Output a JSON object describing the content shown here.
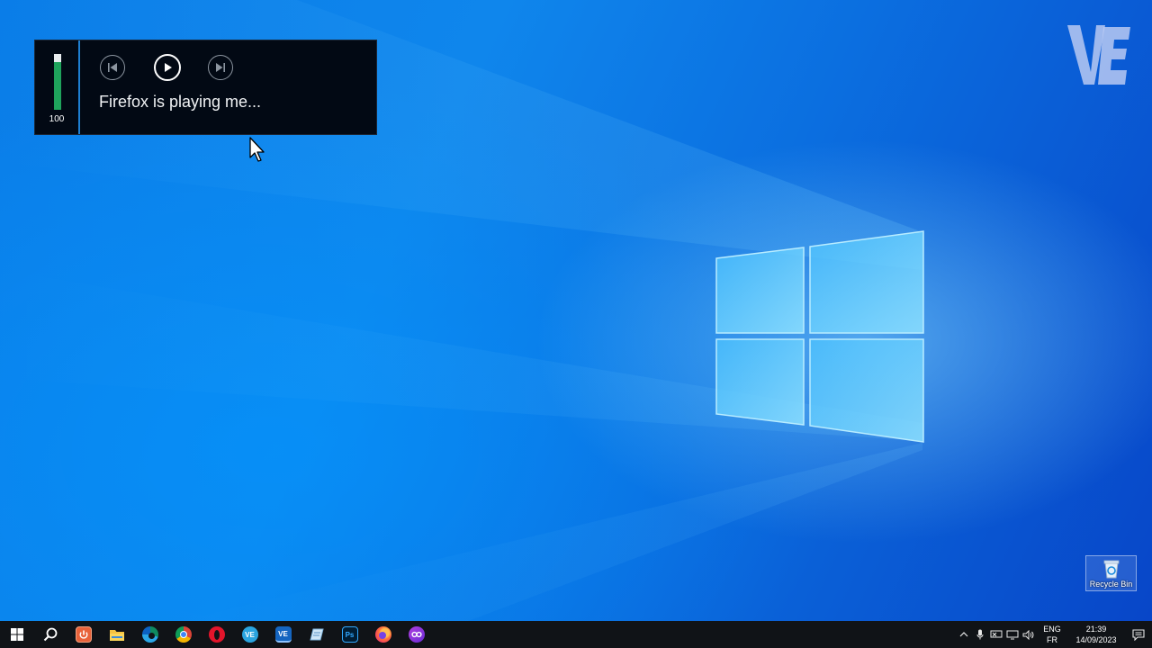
{
  "media": {
    "volume_level": 100,
    "volume_label": "100",
    "title": "Firefox is playing me...",
    "controls": {
      "previous": "previous-track",
      "play": "play",
      "next": "next-track"
    },
    "accent_color": "#1e7fd1",
    "volume_color": "#1fa35c"
  },
  "desktop": {
    "icons": [
      {
        "label": "Recycle Bin",
        "icon": "recycle-bin-icon"
      }
    ]
  },
  "taskbar": {
    "apps": [
      {
        "name": "start",
        "icon": "windows-start-icon"
      },
      {
        "name": "search",
        "icon": "search-icon"
      },
      {
        "name": "app-orange",
        "icon": "power-app-icon"
      },
      {
        "name": "file-explorer",
        "icon": "folder-icon"
      },
      {
        "name": "edge",
        "icon": "edge-icon"
      },
      {
        "name": "chrome",
        "icon": "chrome-icon"
      },
      {
        "name": "opera",
        "icon": "opera-icon"
      },
      {
        "name": "ve-app-1",
        "icon": "ve-icon"
      },
      {
        "name": "ve-app-2",
        "icon": "ve-icon"
      },
      {
        "name": "notes",
        "icon": "notepad-icon"
      },
      {
        "name": "photoshop",
        "icon": "photoshop-icon",
        "label": "Ps"
      },
      {
        "name": "firefox",
        "icon": "firefox-icon"
      },
      {
        "name": "media-app",
        "icon": "media-app-icon"
      }
    ],
    "language": {
      "line1": "ENG",
      "line2": "FR"
    },
    "clock": {
      "time": "21:39",
      "date": "14/09/2023"
    }
  }
}
